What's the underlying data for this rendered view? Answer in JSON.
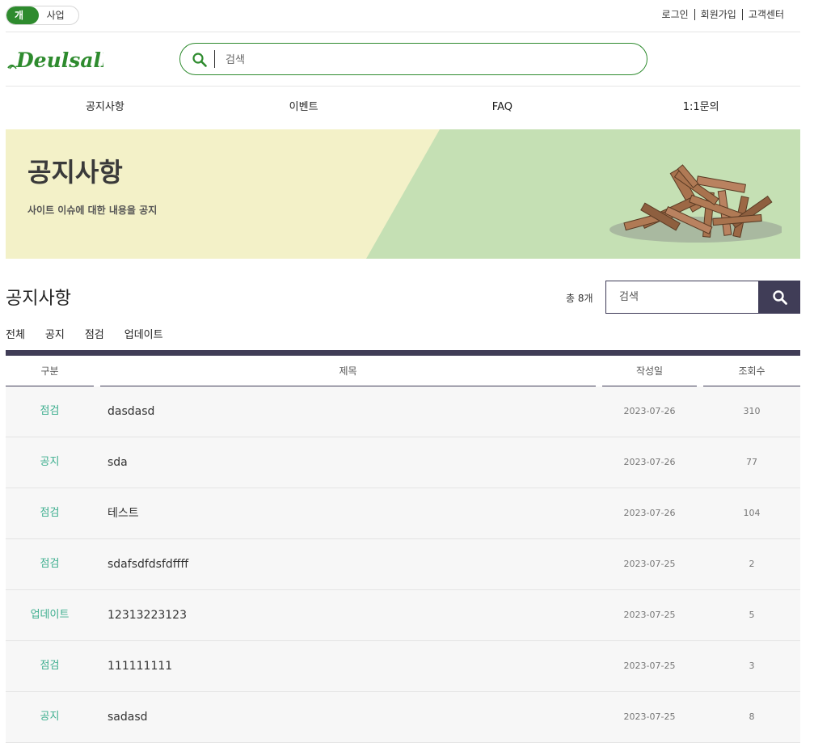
{
  "topbar": {
    "toggle": {
      "personal": "개인",
      "business": "사업자"
    },
    "links": [
      "로그인",
      "회원가입",
      "고객센터"
    ]
  },
  "header": {
    "logo_text": "DeulsalE",
    "search_placeholder": "검색"
  },
  "nav": {
    "items": [
      "공지사항",
      "이벤트",
      "FAQ",
      "1:1문의"
    ]
  },
  "banner": {
    "title": "공지사항",
    "subtitle": "사이트 이슈에 대한 내용을 공지"
  },
  "list": {
    "title": "공지사항",
    "count_text": "총 8개",
    "search_placeholder": "검색",
    "categories": [
      "전체",
      "공지",
      "점검",
      "업데이트"
    ],
    "columns": [
      "구분",
      "제목",
      "작성일",
      "조회수"
    ],
    "rows": [
      {
        "category": "점검",
        "title": "dasdasd",
        "date": "2023-07-26",
        "views": "310"
      },
      {
        "category": "공지",
        "title": "sda",
        "date": "2023-07-26",
        "views": "77"
      },
      {
        "category": "점검",
        "title": "테스트",
        "date": "2023-07-26",
        "views": "104"
      },
      {
        "category": "점검",
        "title": "sdafsdfdsfdffff",
        "date": "2023-07-25",
        "views": "2"
      },
      {
        "category": "업데이트",
        "title": "12313223123",
        "date": "2023-07-25",
        "views": "5"
      },
      {
        "category": "점검",
        "title": "111111111",
        "date": "2023-07-25",
        "views": "3"
      },
      {
        "category": "공지",
        "title": "sadasd",
        "date": "2023-07-25",
        "views": "8"
      }
    ]
  },
  "colors": {
    "brand_green": "#2e8b2e",
    "category_teal": "#3cae8e",
    "accent_navy": "#403d57",
    "banner_yellow": "#f3f1c8",
    "banner_green": "#c5e0b4"
  },
  "icons": {
    "search": "search-icon",
    "logo": "sprout-icon",
    "banner_art": "wood-pile-icon"
  }
}
